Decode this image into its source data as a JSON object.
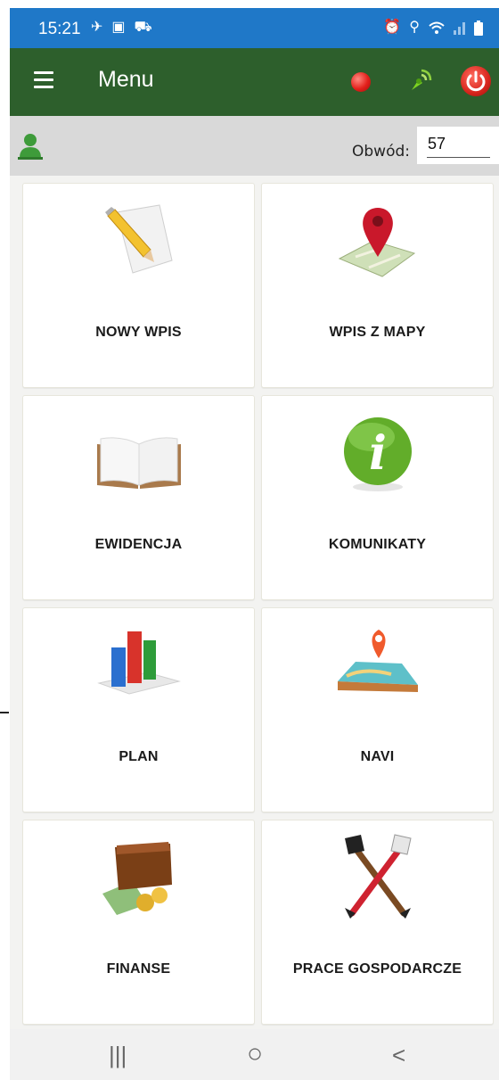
{
  "status_bar": {
    "time": "15:21",
    "left_icons": [
      "flight-icon",
      "gallery-icon",
      "car-icon"
    ],
    "right_icons": [
      "alarm-icon",
      "location-icon",
      "wifi-icon",
      "signal-icon",
      "battery-icon"
    ]
  },
  "app_bar": {
    "title": "Menu",
    "icons": [
      "hamburger-menu-icon",
      "record-icon",
      "gps-signal-icon",
      "power-icon"
    ]
  },
  "sub_bar": {
    "circuit_label": "Obwód:",
    "circuit_value": "57"
  },
  "tiles": [
    {
      "label": "NOWY WPIS",
      "icon": "pencil-paper-icon"
    },
    {
      "label": "WPIS Z MAPY",
      "icon": "map-pin-icon"
    },
    {
      "label": "EWIDENCJA",
      "icon": "open-book-icon"
    },
    {
      "label": "KOMUNIKATY",
      "icon": "info-icon"
    },
    {
      "label": "PLAN",
      "icon": "bar-chart-icon"
    },
    {
      "label": "NAVI",
      "icon": "map-navigation-icon"
    },
    {
      "label": "FINANSE",
      "icon": "wallet-icon"
    },
    {
      "label": "PRACE GOSPODARCZE",
      "icon": "crossed-axes-icon"
    }
  ],
  "nav_bar": {
    "recent": "|||",
    "home": "○",
    "back": "<"
  },
  "colors": {
    "status_bar": "#1f78c8",
    "app_bar": "#2d5f2c",
    "sub_bar": "#d9d9d9",
    "background": "#f3f3f1"
  }
}
